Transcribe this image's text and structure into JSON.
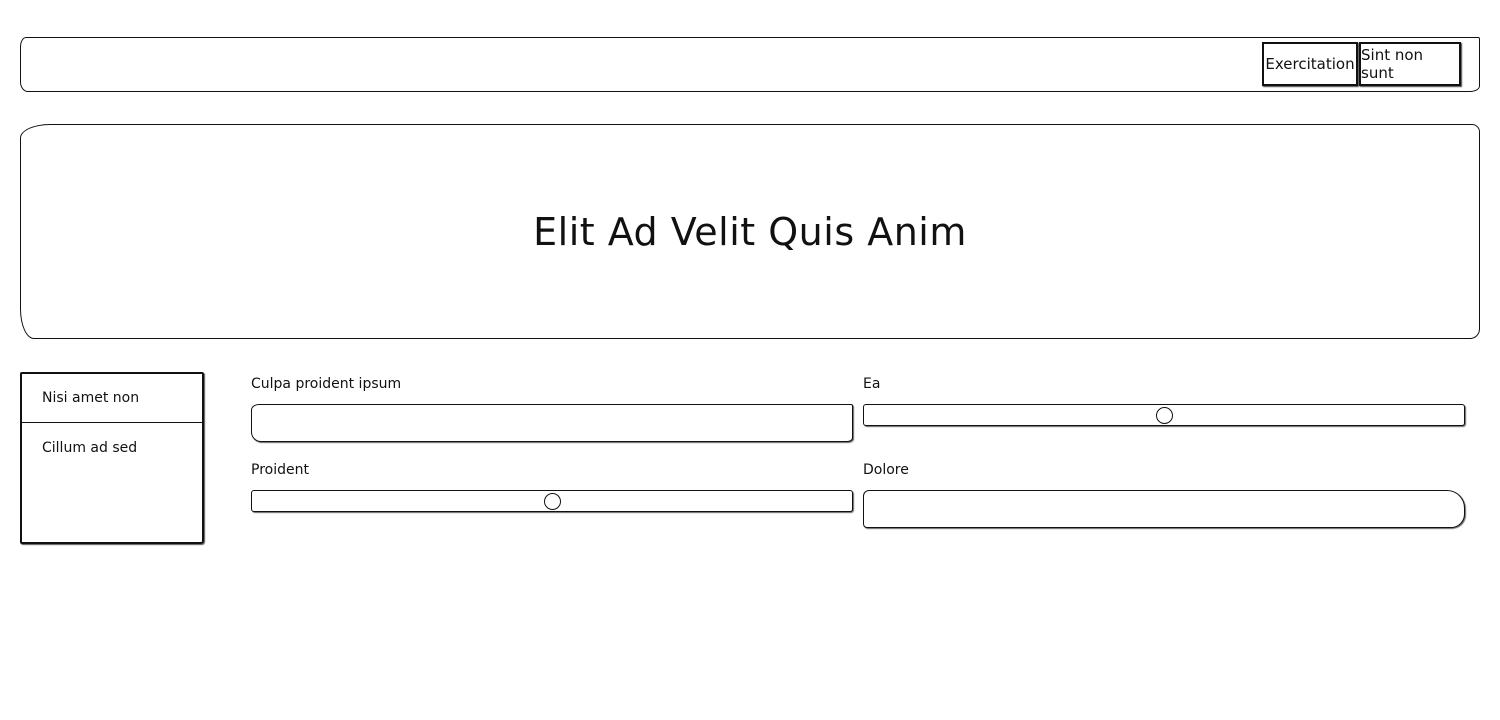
{
  "header": {
    "buttons": [
      {
        "label": "Exercitation"
      },
      {
        "label": "Sint non sunt"
      }
    ]
  },
  "hero": {
    "title": "Elit Ad Velit Quis Anim"
  },
  "sidebar": {
    "items": [
      {
        "label": "Nisi amet non"
      },
      {
        "label": "Cillum ad sed"
      }
    ]
  },
  "form": {
    "fields": {
      "culpa": {
        "label": "Culpa proident ipsum",
        "value": "",
        "placeholder": ""
      },
      "ea": {
        "label": "Ea",
        "value_fraction": 0.5
      },
      "proident": {
        "label": "Proident",
        "value_fraction": 0.5
      },
      "dolore": {
        "label": "Dolore",
        "value": "",
        "placeholder": ""
      }
    }
  }
}
